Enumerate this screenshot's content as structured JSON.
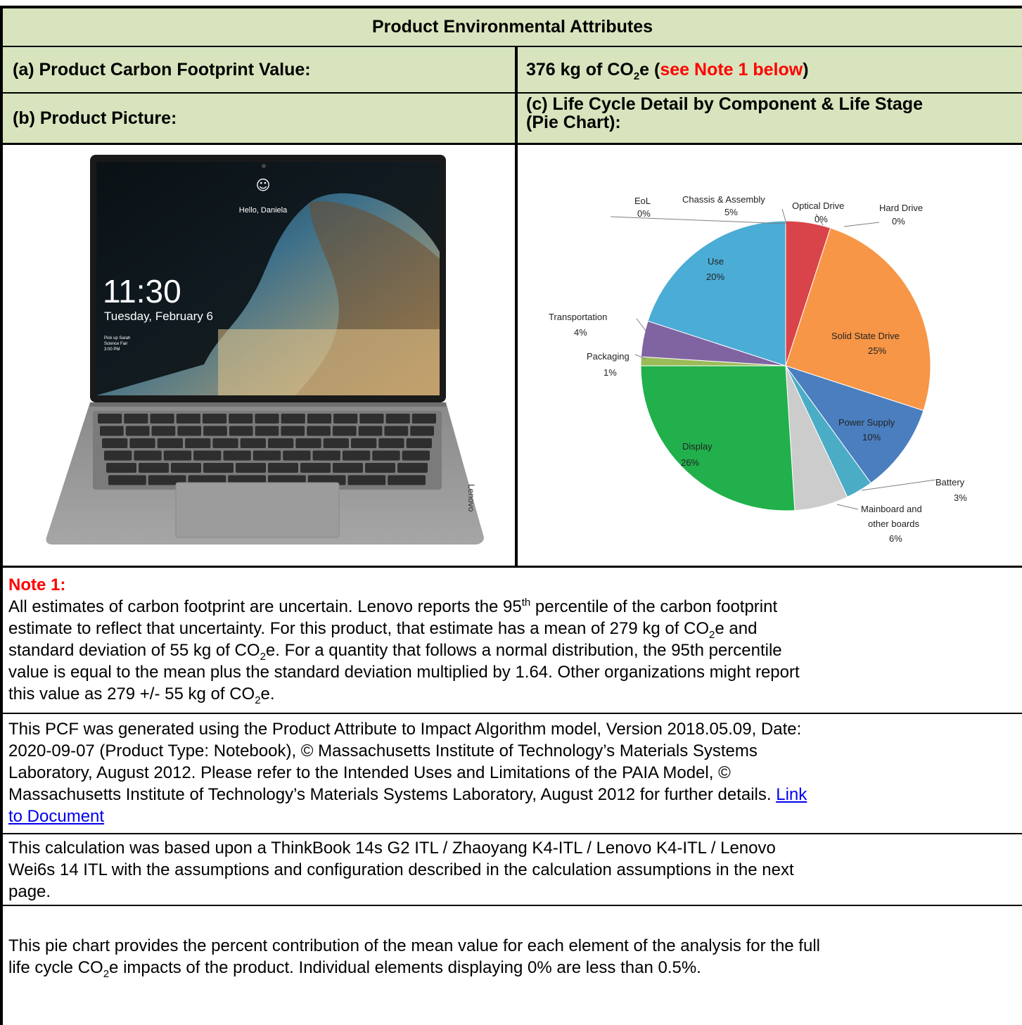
{
  "header": {
    "title": "Product Environmental Attributes",
    "a_label": "(a) Product Carbon Footprint Value:",
    "a_value_main": "376 kg of CO",
    "a_value_sub": "2",
    "a_value_tail": "e (",
    "a_note_ref": "see Note 1 below",
    "a_close": ")",
    "b_label": "(b) Product Picture:",
    "c_label_line1": "(c) Life Cycle Detail by Component & Life Stage",
    "c_label_line2": "(Pie Chart):"
  },
  "laptop": {
    "time": "11:30",
    "date": "Tuesday, February 6",
    "greeting": "Hello, Daniela",
    "reminder_1": "Pick up Sarah",
    "reminder_2": "Science Fair",
    "reminder_3": "3:00 PM",
    "brand": "Lenovo"
  },
  "chart_data": {
    "type": "pie",
    "slices": [
      {
        "label": "EoL",
        "value": 0,
        "pct": "0%",
        "color": "#70ad47"
      },
      {
        "label": "Chassis & Assembly",
        "value": 5,
        "pct": "5%",
        "color": "#d9444a"
      },
      {
        "label": "Optical Drive",
        "value": 0,
        "pct": "0%",
        "color": "#a5a5a5"
      },
      {
        "label": "Hard Drive",
        "value": 0,
        "pct": "0%",
        "color": "#ffc000"
      },
      {
        "label": "Solid State Drive",
        "value": 25,
        "pct": "25%",
        "color": "#f79646"
      },
      {
        "label": "Power Supply",
        "value": 10,
        "pct": "10%",
        "color": "#4a7ebf"
      },
      {
        "label": "Battery",
        "value": 3,
        "pct": "3%",
        "color": "#4bacc6"
      },
      {
        "label": "Mainboard and other boards",
        "value": 6,
        "pct": "6%",
        "color": "#cccccc"
      },
      {
        "label": "Display",
        "value": 26,
        "pct": "26%",
        "color": "#21b04b"
      },
      {
        "label": "Packaging",
        "value": 1,
        "pct": "1%",
        "color": "#9bbb59"
      },
      {
        "label": "Transportation",
        "value": 4,
        "pct": "4%",
        "color": "#8064a2"
      },
      {
        "label": "Use",
        "value": 20,
        "pct": "20%",
        "color": "#4bacd6"
      }
    ],
    "labels": {
      "eol": [
        "EoL",
        "0%"
      ],
      "chassis": [
        "Chassis & Assembly",
        "5%"
      ],
      "optical": [
        "Optical Drive",
        "0%"
      ],
      "hard": [
        "Hard Drive",
        "0%"
      ],
      "use": [
        "Use",
        "20%"
      ],
      "ssd": [
        "Solid State Drive",
        "25%"
      ],
      "transport": [
        "Transportation",
        "4%"
      ],
      "packaging": [
        "Packaging",
        "1%"
      ],
      "power": [
        "Power Supply",
        "10%"
      ],
      "display": [
        "Display",
        "26%"
      ],
      "battery": [
        "Battery",
        "3%"
      ],
      "mainboard": [
        "Mainboard and",
        "other boards",
        "6%"
      ]
    }
  },
  "note1": {
    "heading": "Note 1:",
    "l1a": "All estimates of carbon footprint are uncertain. Lenovo reports the 95",
    "l1sup": "th",
    "l1b": " percentile of the carbon footprint",
    "l2a": "estimate to reflect that uncertainty. For this product, that estimate has a mean of 279 kg of CO",
    "l2sub": "2",
    "l2b": "e and",
    "l3a": "standard deviation of 55 kg of CO",
    "l3sub": "2",
    "l3b": "e. For a quantity that follows a normal distribution, the 95th percentile",
    "l4": "value is equal to the mean plus the standard deviation multiplied by 1.64. Other organizations might report",
    "l5a": "this value as 279 +/- 55 kg of CO",
    "l5sub": "2",
    "l5b": "e."
  },
  "pcf": {
    "l1": "This PCF was generated using the Product Attribute to Impact Algorithm model, Version 2018.05.09, Date:",
    "l2": "2020-09-07 (Product Type: Notebook), © Massachusetts Institute of Technology’s Materials Systems",
    "l3": "Laboratory, August 2012. Please refer to the Intended Uses and Limitations of the PAIA Model, ©",
    "l4": "Massachusetts Institute of Technology’s Materials Systems Laboratory, August 2012 for further details.",
    "link_part1": "Link",
    "link_part2": "to Document"
  },
  "calc": {
    "l1": "This calculation was based upon a ThinkBook 14s G2 ITL  / Zhaoyang K4-ITL / Lenovo K4-ITL / Lenovo",
    "l2": "Wei6s 14 ITL  with the assumptions and configuration described in the calculation assumptions in the next",
    "l3": "page."
  },
  "pie_desc": {
    "l1": "This pie chart provides the percent contribution of the mean value for each element of the analysis for the full",
    "l2a": "life cycle CO",
    "l2sub": "2",
    "l2b": "e impacts of the product. Individual elements displaying 0% are less than 0.5%."
  }
}
